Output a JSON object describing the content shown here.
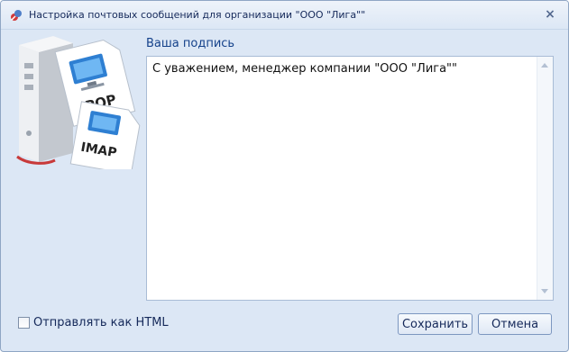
{
  "window": {
    "title": "Настройка почтовых сообщений для организации \"ООО \"Лига\"\"",
    "close_symbol": "×"
  },
  "illustration": {
    "icons": [
      "server-tower-icon",
      "pop-document-icon",
      "imap-document-icon"
    ],
    "pop_label": "POP",
    "imap_label": "IMAP"
  },
  "signature": {
    "label": "Ваша подпись",
    "value": "С уважением, менеджер компании \"ООО \"Лига\"\""
  },
  "options": {
    "send_html_label": "Отправлять как HTML",
    "send_html_checked": false
  },
  "buttons": {
    "save_label": "Сохранить",
    "cancel_label": "Отмена"
  },
  "colors": {
    "window_bg": "#dce7f5",
    "label_text": "#15428b",
    "border": "#8fa6c4"
  }
}
